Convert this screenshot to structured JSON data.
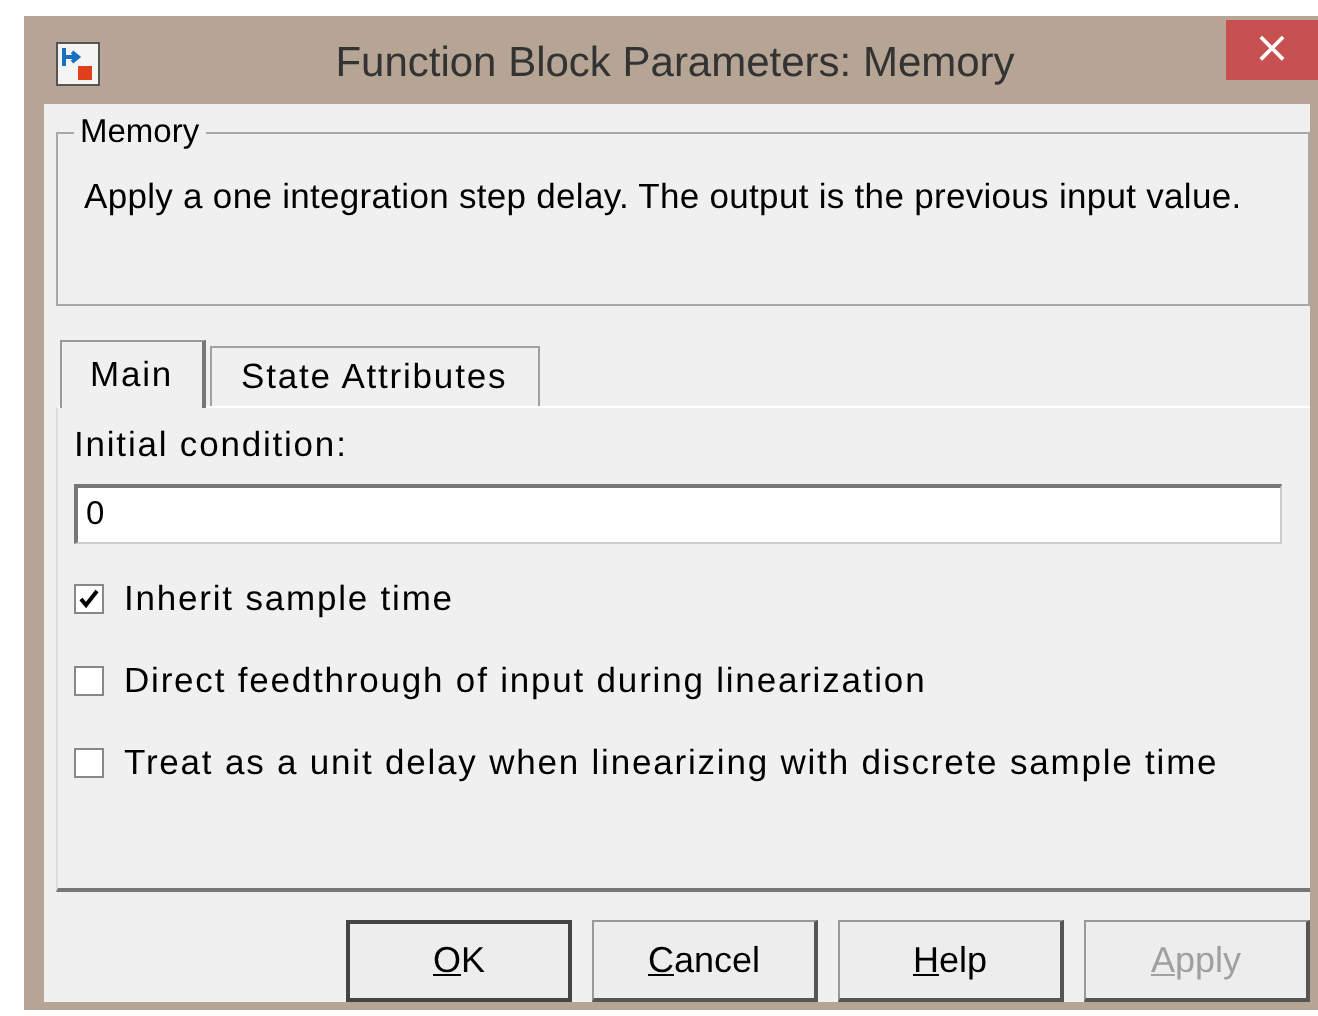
{
  "window": {
    "title": "Function Block Parameters: Memory",
    "close": "×"
  },
  "group": {
    "legend": "Memory",
    "description": "Apply a one integration step delay. The output is the previous input value."
  },
  "tabs": [
    {
      "label": "Main",
      "selected": true
    },
    {
      "label": "State Attributes",
      "selected": false
    }
  ],
  "parameter": {
    "label": "Initial condition:",
    "value": "0"
  },
  "checkboxes": [
    {
      "label": "Inherit sample time",
      "checked": true
    },
    {
      "label": "Direct feedthrough of input during linearization",
      "checked": false
    },
    {
      "label": "Treat as a unit delay when linearizing with discrete sample time",
      "checked": false
    }
  ],
  "buttons": [
    {
      "label": "OK",
      "default": true,
      "disabled": false
    },
    {
      "label": "Cancel",
      "default": false,
      "disabled": false
    },
    {
      "label": "Help",
      "default": false,
      "disabled": false
    },
    {
      "label": "Apply",
      "default": false,
      "disabled": true
    }
  ]
}
